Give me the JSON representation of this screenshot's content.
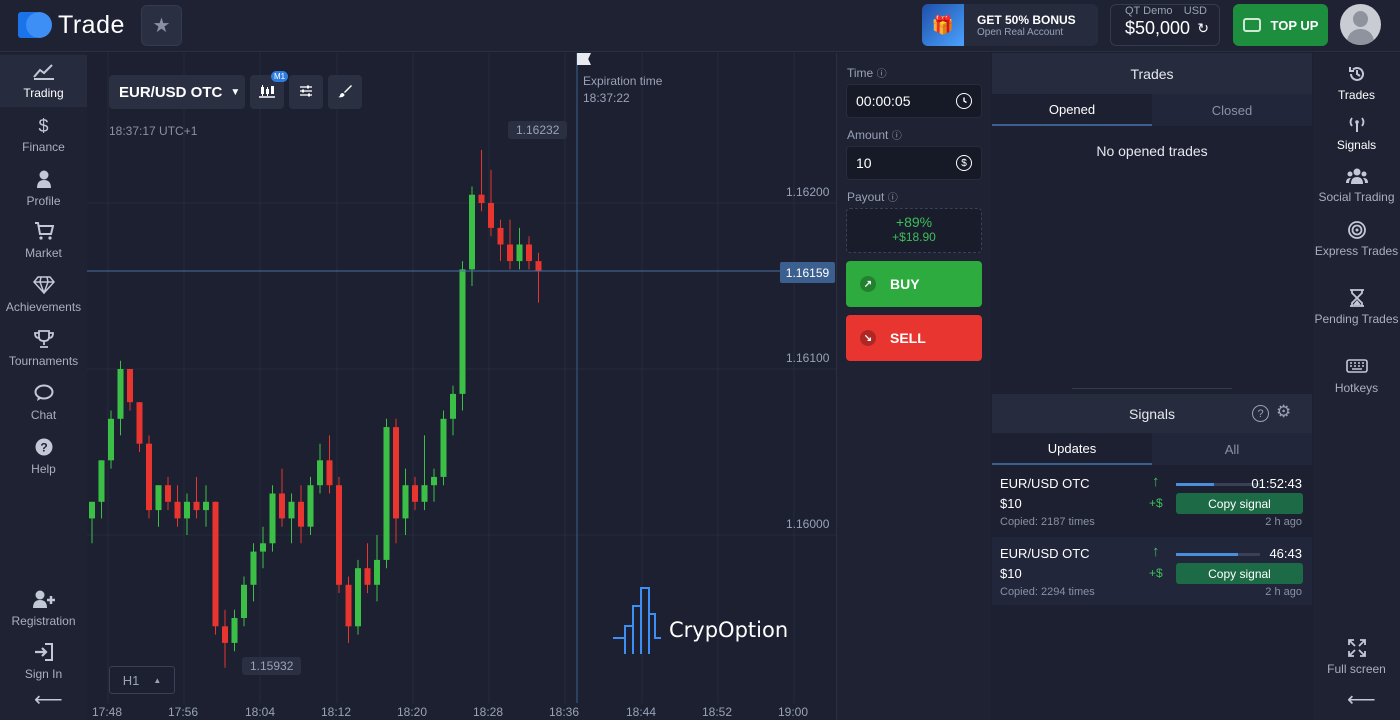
{
  "header": {
    "logo_text": "Trade",
    "bonus_title": "GET 50% BONUS",
    "bonus_subtitle": "Open Real Account",
    "account_label": "QT Demo",
    "currency": "USD",
    "balance": "$50,000",
    "topup_label": "TOP UP"
  },
  "left_nav": [
    {
      "label": "Trading",
      "icon": "chart-line-icon"
    },
    {
      "label": "Finance",
      "icon": "dollar-icon"
    },
    {
      "label": "Profile",
      "icon": "user-icon"
    },
    {
      "label": "Market",
      "icon": "cart-icon"
    },
    {
      "label": "Achievements",
      "icon": "diamond-icon"
    },
    {
      "label": "Tournaments",
      "icon": "trophy-icon"
    },
    {
      "label": "Chat",
      "icon": "chat-icon"
    },
    {
      "label": "Help",
      "icon": "help-icon"
    },
    {
      "label": "Registration",
      "icon": "user-plus-icon"
    },
    {
      "label": "Sign In",
      "icon": "sign-in-icon"
    }
  ],
  "chart": {
    "asset": "EUR/USD OTC",
    "interval_badge": "M1",
    "server_time": "18:37:17 UTC+1",
    "expiration_label": "Expiration time",
    "expiration_time": "18:37:22",
    "high_label": "1.16232",
    "low_label": "1.15932",
    "current_price": "1.16159",
    "timeframe": "H1",
    "watermark": "CrypOption",
    "price_ticks": [
      "1.16200",
      "1.16100",
      "1.16000"
    ],
    "time_ticks": [
      "17:48",
      "17:56",
      "18:04",
      "18:12",
      "18:20",
      "18:28",
      "18:36",
      "18:44",
      "18:52",
      "19:00"
    ]
  },
  "chart_data": {
    "type": "candlestick",
    "ylim": [
      1.1588,
      1.163
    ],
    "candles": [
      {
        "o": 1.1601,
        "h": 1.1602,
        "l": 1.15995,
        "c": 1.1602
      },
      {
        "o": 1.1602,
        "h": 1.16045,
        "l": 1.1601,
        "c": 1.16045
      },
      {
        "o": 1.16045,
        "h": 1.16075,
        "l": 1.1604,
        "c": 1.1607
      },
      {
        "o": 1.1607,
        "h": 1.16105,
        "l": 1.1606,
        "c": 1.161
      },
      {
        "o": 1.161,
        "h": 1.161,
        "l": 1.16075,
        "c": 1.1608
      },
      {
        "o": 1.1608,
        "h": 1.1608,
        "l": 1.1605,
        "c": 1.16055
      },
      {
        "o": 1.16055,
        "h": 1.1606,
        "l": 1.1601,
        "c": 1.16015
      },
      {
        "o": 1.16015,
        "h": 1.1603,
        "l": 1.16005,
        "c": 1.1603
      },
      {
        "o": 1.1603,
        "h": 1.16035,
        "l": 1.16015,
        "c": 1.1602
      },
      {
        "o": 1.1602,
        "h": 1.1603,
        "l": 1.16005,
        "c": 1.1601
      },
      {
        "o": 1.1601,
        "h": 1.16025,
        "l": 1.16,
        "c": 1.1602
      },
      {
        "o": 1.1602,
        "h": 1.16035,
        "l": 1.1601,
        "c": 1.16015
      },
      {
        "o": 1.16015,
        "h": 1.1603,
        "l": 1.16005,
        "c": 1.1602
      },
      {
        "o": 1.1602,
        "h": 1.1602,
        "l": 1.1594,
        "c": 1.15945
      },
      {
        "o": 1.15945,
        "h": 1.15955,
        "l": 1.1592,
        "c": 1.15935
      },
      {
        "o": 1.15935,
        "h": 1.15955,
        "l": 1.1593,
        "c": 1.1595
      },
      {
        "o": 1.1595,
        "h": 1.15975,
        "l": 1.15945,
        "c": 1.1597
      },
      {
        "o": 1.1597,
        "h": 1.15995,
        "l": 1.1596,
        "c": 1.1599
      },
      {
        "o": 1.1599,
        "h": 1.16005,
        "l": 1.1598,
        "c": 1.15995
      },
      {
        "o": 1.15995,
        "h": 1.1603,
        "l": 1.1599,
        "c": 1.16025
      },
      {
        "o": 1.16025,
        "h": 1.1604,
        "l": 1.16005,
        "c": 1.1601
      },
      {
        "o": 1.1601,
        "h": 1.16025,
        "l": 1.15995,
        "c": 1.1602
      },
      {
        "o": 1.1602,
        "h": 1.1603,
        "l": 1.15995,
        "c": 1.16005
      },
      {
        "o": 1.16005,
        "h": 1.16035,
        "l": 1.16,
        "c": 1.1603
      },
      {
        "o": 1.1603,
        "h": 1.16055,
        "l": 1.16025,
        "c": 1.16045
      },
      {
        "o": 1.16045,
        "h": 1.1606,
        "l": 1.16025,
        "c": 1.1603
      },
      {
        "o": 1.1603,
        "h": 1.16035,
        "l": 1.15965,
        "c": 1.1597
      },
      {
        "o": 1.1597,
        "h": 1.15975,
        "l": 1.15935,
        "c": 1.15945
      },
      {
        "o": 1.15945,
        "h": 1.15985,
        "l": 1.1594,
        "c": 1.1598
      },
      {
        "o": 1.1598,
        "h": 1.15995,
        "l": 1.15965,
        "c": 1.1597
      },
      {
        "o": 1.1597,
        "h": 1.16,
        "l": 1.1596,
        "c": 1.15985
      },
      {
        "o": 1.15985,
        "h": 1.1607,
        "l": 1.1598,
        "c": 1.16065
      },
      {
        "o": 1.16065,
        "h": 1.1607,
        "l": 1.15995,
        "c": 1.1601
      },
      {
        "o": 1.1601,
        "h": 1.1604,
        "l": 1.16,
        "c": 1.1603
      },
      {
        "o": 1.1603,
        "h": 1.16035,
        "l": 1.16015,
        "c": 1.1602
      },
      {
        "o": 1.1602,
        "h": 1.1606,
        "l": 1.16015,
        "c": 1.1603
      },
      {
        "o": 1.1603,
        "h": 1.1604,
        "l": 1.1602,
        "c": 1.16035
      },
      {
        "o": 1.16035,
        "h": 1.16075,
        "l": 1.1603,
        "c": 1.1607
      },
      {
        "o": 1.1607,
        "h": 1.1609,
        "l": 1.1606,
        "c": 1.16085
      },
      {
        "o": 1.16085,
        "h": 1.16165,
        "l": 1.16075,
        "c": 1.1616
      },
      {
        "o": 1.1616,
        "h": 1.1621,
        "l": 1.1615,
        "c": 1.16205
      },
      {
        "o": 1.16205,
        "h": 1.16232,
        "l": 1.16195,
        "c": 1.162
      },
      {
        "o": 1.162,
        "h": 1.1622,
        "l": 1.1618,
        "c": 1.16185
      },
      {
        "o": 1.16185,
        "h": 1.1619,
        "l": 1.16165,
        "c": 1.16175
      },
      {
        "o": 1.16175,
        "h": 1.1619,
        "l": 1.1616,
        "c": 1.16165
      },
      {
        "o": 1.16165,
        "h": 1.16185,
        "l": 1.1616,
        "c": 1.16175
      },
      {
        "o": 1.16175,
        "h": 1.1618,
        "l": 1.1616,
        "c": 1.16165
      },
      {
        "o": 1.16165,
        "h": 1.1617,
        "l": 1.1614,
        "c": 1.16159
      }
    ],
    "colors": {
      "up": "#3cbf47",
      "down": "#e8352f"
    }
  },
  "trade_panel": {
    "time_label": "Time",
    "time_value": "00:00:05",
    "amount_label": "Amount",
    "amount_value": "10",
    "payout_label": "Payout",
    "payout_percent": "+89%",
    "payout_amount": "+$18.90",
    "buy_label": "BUY",
    "sell_label": "SELL"
  },
  "trades": {
    "title": "Trades",
    "tabs": [
      "Opened",
      "Closed"
    ],
    "empty_text": "No opened trades"
  },
  "signals": {
    "title": "Signals",
    "tabs": [
      "Updates",
      "All"
    ],
    "items": [
      {
        "asset": "EUR/USD OTC",
        "amount": "$10",
        "copied": "Copied: 2187 times",
        "time": "01:52:43",
        "copy_label": "Copy signal",
        "ago": "2 h ago",
        "plus": "+$",
        "progress": 0.45
      },
      {
        "asset": "EUR/USD OTC",
        "amount": "$10",
        "copied": "Copied: 2294 times",
        "time": "46:43",
        "copy_label": "Copy signal",
        "ago": "2 h ago",
        "plus": "+$",
        "progress": 0.74
      }
    ]
  },
  "right_nav": [
    {
      "label": "Trades",
      "icon": "history-icon"
    },
    {
      "label": "Signals",
      "icon": "signal-icon"
    },
    {
      "label": "Social Trading",
      "icon": "users-icon"
    },
    {
      "label": "Express Trades",
      "icon": "target-icon"
    },
    {
      "label": "Pending Trades",
      "icon": "hourglass-icon"
    },
    {
      "label": "Hotkeys",
      "icon": "keyboard-icon"
    },
    {
      "label": "Full screen",
      "icon": "fullscreen-icon"
    }
  ]
}
